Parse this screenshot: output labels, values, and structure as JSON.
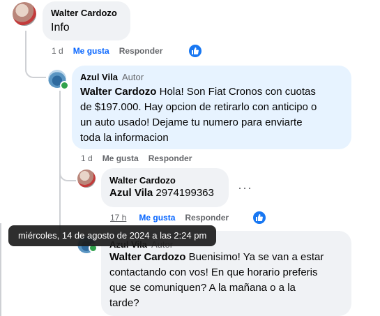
{
  "comments": [
    {
      "author": "Walter Cardozo",
      "text": "Info",
      "time": "1 d",
      "like_label": "Me gusta",
      "reply_label": "Responder"
    },
    {
      "author": "Azul Vila",
      "badge": "Autor",
      "mention": "Walter Cardozo",
      "text_lines": [
        " Hola! Son Fiat Cronos con cuotas",
        "de $197.000. Hay opcion de retirarlo con anticipo o",
        "un auto usado! Dejame tu numero para enviarte",
        "toda la informacion"
      ],
      "time": "1 d",
      "like_label": "Me gusta",
      "reply_label": "Responder"
    },
    {
      "author": "Walter Cardozo",
      "mention": "Azul Vila",
      "text": " 2974199363",
      "time": "17 h",
      "like_label": "Me gusta",
      "reply_label": "Responder",
      "more_label": "···"
    },
    {
      "author": "Azul Vila",
      "badge": "Autor",
      "mention": "Walter Cardozo",
      "text_lines": [
        " Buenisimo! Ya se van a estar",
        "contactando con vos! En que horario preferis",
        "que se comuniquen? A la mañana o a la",
        "tarde?"
      ]
    }
  ],
  "tooltip": "miércoles, 14 de agosto de 2024 a las 2:24 pm",
  "colors": {
    "like_blue": "#0866ff",
    "bubble_grey": "#f0f2f5",
    "bubble_blue": "#e7f3ff",
    "online_green": "#31a24c"
  },
  "icons": [
    "like-reaction-icon",
    "online-status-icon",
    "more-options-icon"
  ]
}
